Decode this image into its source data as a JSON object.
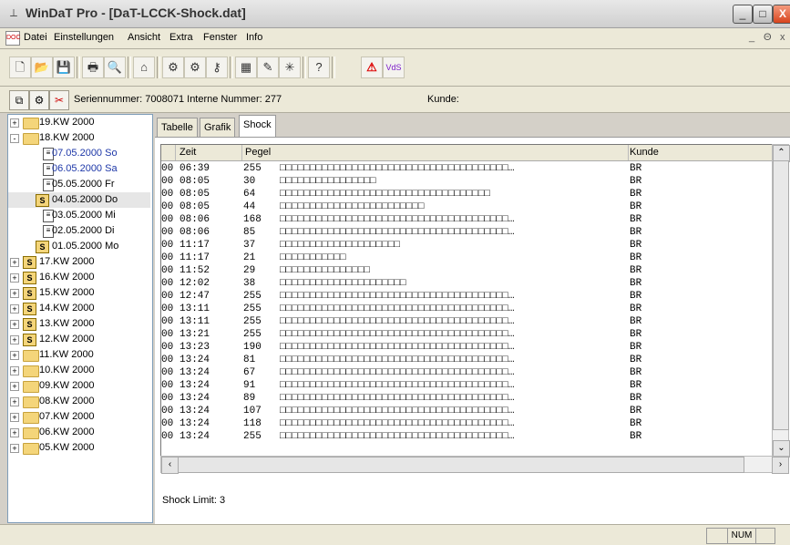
{
  "window": {
    "title": "WinDaT Pro - [DaT-LCCK-Shock.dat]",
    "buttons": [
      "_",
      "□",
      "X"
    ]
  },
  "menu": [
    "Datei",
    "Einstellungen",
    "Ansicht",
    "Extra",
    "Fenster",
    "Info"
  ],
  "mdi_controls": [
    "_",
    "Θ",
    "x"
  ],
  "toolbar_icons": [
    "new-doc-icon",
    "open-folder-icon",
    "save-icon",
    "print-icon",
    "print-preview-icon",
    "device-icon",
    "settings-gear-icon",
    "cog-icon",
    "key-icon",
    "graph-icon",
    "tools-icon",
    "sensor-icon",
    "help-icon",
    "warning-triangle-icon",
    "vds-icon"
  ],
  "infobar": {
    "serial_label": "Seriennummer: 7008071 Interne Nummer: 277",
    "customer_label": "Kunde:"
  },
  "tree": [
    {
      "label": "19.KW 2000",
      "type": "folder",
      "expander": "+",
      "indent": 0
    },
    {
      "label": "18.KW 2000",
      "type": "folder-open",
      "expander": "-",
      "indent": 0
    },
    {
      "label": "07.05.2000 So",
      "type": "doc",
      "color": "blue",
      "indent": 1
    },
    {
      "label": "06.05.2000 Sa",
      "type": "doc",
      "color": "blue",
      "indent": 1
    },
    {
      "label": "05.05.2000 Fr",
      "type": "doc",
      "indent": 1
    },
    {
      "label": "04.05.2000 Do",
      "type": "sdoc",
      "selected": true,
      "indent": 1
    },
    {
      "label": "03.05.2000 Mi",
      "type": "doc",
      "indent": 1
    },
    {
      "label": "02.05.2000 Di",
      "type": "doc",
      "indent": 1
    },
    {
      "label": "01.05.2000 Mo",
      "type": "sdoc",
      "indent": 1
    },
    {
      "label": "17.KW 2000",
      "type": "sfolder",
      "expander": "+",
      "indent": 0
    },
    {
      "label": "16.KW 2000",
      "type": "sfolder",
      "expander": "+",
      "indent": 0
    },
    {
      "label": "15.KW 2000",
      "type": "sfolder",
      "expander": "+",
      "indent": 0
    },
    {
      "label": "14.KW 2000",
      "type": "sfolder",
      "expander": "+",
      "indent": 0
    },
    {
      "label": "13.KW 2000",
      "type": "sfolder",
      "expander": "+",
      "indent": 0
    },
    {
      "label": "12.KW 2000",
      "type": "sfolder",
      "expander": "+",
      "indent": 0
    },
    {
      "label": "11.KW 2000",
      "type": "folder",
      "expander": "+",
      "indent": 0
    },
    {
      "label": "10.KW 2000",
      "type": "folder",
      "expander": "+",
      "indent": 0
    },
    {
      "label": "09.KW 2000",
      "type": "folder",
      "expander": "+",
      "indent": 0
    },
    {
      "label": "08.KW 2000",
      "type": "folder",
      "expander": "+",
      "indent": 0
    },
    {
      "label": "07.KW 2000",
      "type": "folder",
      "expander": "+",
      "indent": 0
    },
    {
      "label": "06.KW 2000",
      "type": "folder",
      "expander": "+",
      "indent": 0
    },
    {
      "label": "05.KW 2000",
      "type": "folder",
      "expander": "+",
      "indent": 0
    }
  ],
  "tabs": [
    "Tabelle",
    "Grafik",
    "Shock"
  ],
  "active_tab": "Shock",
  "table": {
    "columns": [
      "Zeit",
      "Pegel",
      "Kunde"
    ],
    "rows": [
      {
        "prefix": "00",
        "time": "06:39",
        "level": "255",
        "bar": "□□□□□□□□□□□□□□□□□□□□□□□□□□□□□□□□□□□□□□…",
        "customer": "BR"
      },
      {
        "prefix": "00",
        "time": "08:05",
        "level": "30",
        "bar": "□□□□□□□□□□□□□□□□",
        "customer": "BR"
      },
      {
        "prefix": "00",
        "time": "08:05",
        "level": "64",
        "bar": "□□□□□□□□□□□□□□□□□□□□□□□□□□□□□□□□□□□",
        "customer": "BR"
      },
      {
        "prefix": "00",
        "time": "08:05",
        "level": "44",
        "bar": "□□□□□□□□□□□□□□□□□□□□□□□□",
        "customer": "BR"
      },
      {
        "prefix": "00",
        "time": "08:06",
        "level": "168",
        "bar": "□□□□□□□□□□□□□□□□□□□□□□□□□□□□□□□□□□□□□□…",
        "customer": "BR"
      },
      {
        "prefix": "00",
        "time": "08:06",
        "level": "85",
        "bar": "□□□□□□□□□□□□□□□□□□□□□□□□□□□□□□□□□□□□□□…",
        "customer": "BR"
      },
      {
        "prefix": "00",
        "time": "11:17",
        "level": "37",
        "bar": "□□□□□□□□□□□□□□□□□□□□",
        "customer": "BR"
      },
      {
        "prefix": "00",
        "time": "11:17",
        "level": "21",
        "bar": "□□□□□□□□□□□",
        "customer": "BR"
      },
      {
        "prefix": "00",
        "time": "11:52",
        "level": "29",
        "bar": "□□□□□□□□□□□□□□□",
        "customer": "BR"
      },
      {
        "prefix": "00",
        "time": "12:02",
        "level": "38",
        "bar": "□□□□□□□□□□□□□□□□□□□□□",
        "customer": "BR"
      },
      {
        "prefix": "00",
        "time": "12:47",
        "level": "255",
        "bar": "□□□□□□□□□□□□□□□□□□□□□□□□□□□□□□□□□□□□□□…",
        "customer": "BR"
      },
      {
        "prefix": "00",
        "time": "13:11",
        "level": "255",
        "bar": "□□□□□□□□□□□□□□□□□□□□□□□□□□□□□□□□□□□□□□…",
        "customer": "BR"
      },
      {
        "prefix": "00",
        "time": "13:11",
        "level": "255",
        "bar": "□□□□□□□□□□□□□□□□□□□□□□□□□□□□□□□□□□□□□□…",
        "customer": "BR"
      },
      {
        "prefix": "00",
        "time": "13:21",
        "level": "255",
        "bar": "□□□□□□□□□□□□□□□□□□□□□□□□□□□□□□□□□□□□□□…",
        "customer": "BR"
      },
      {
        "prefix": "00",
        "time": "13:23",
        "level": "190",
        "bar": "□□□□□□□□□□□□□□□□□□□□□□□□□□□□□□□□□□□□□□…",
        "customer": "BR"
      },
      {
        "prefix": "00",
        "time": "13:24",
        "level": "81",
        "bar": "□□□□□□□□□□□□□□□□□□□□□□□□□□□□□□□□□□□□□□…",
        "customer": "BR"
      },
      {
        "prefix": "00",
        "time": "13:24",
        "level": "67",
        "bar": "□□□□□□□□□□□□□□□□□□□□□□□□□□□□□□□□□□□□□□…",
        "customer": "BR"
      },
      {
        "prefix": "00",
        "time": "13:24",
        "level": "91",
        "bar": "□□□□□□□□□□□□□□□□□□□□□□□□□□□□□□□□□□□□□□…",
        "customer": "BR"
      },
      {
        "prefix": "00",
        "time": "13:24",
        "level": "89",
        "bar": "□□□□□□□□□□□□□□□□□□□□□□□□□□□□□□□□□□□□□□…",
        "customer": "BR"
      },
      {
        "prefix": "00",
        "time": "13:24",
        "level": "107",
        "bar": "□□□□□□□□□□□□□□□□□□□□□□□□□□□□□□□□□□□□□□…",
        "customer": "BR"
      },
      {
        "prefix": "00",
        "time": "13:24",
        "level": "118",
        "bar": "□□□□□□□□□□□□□□□□□□□□□□□□□□□□□□□□□□□□□□…",
        "customer": "BR"
      },
      {
        "prefix": "00",
        "time": "13:24",
        "level": "255",
        "bar": "□□□□□□□□□□□□□□□□□□□□□□□□□□□□□□□□□□□□□□…",
        "customer": "BR"
      }
    ]
  },
  "shock_limit": "Shock Limit:  3",
  "status": {
    "num": "NUM"
  }
}
